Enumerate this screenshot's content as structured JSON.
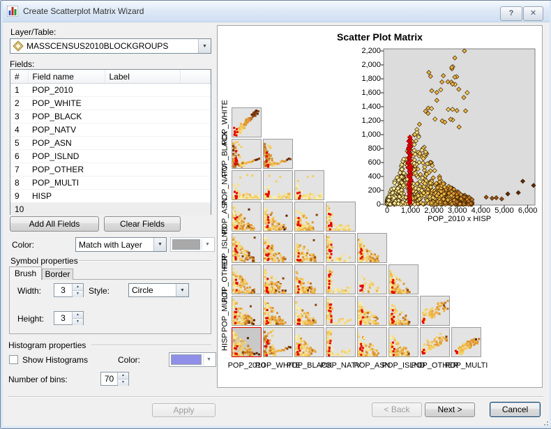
{
  "window": {
    "title": "Create Scatterplot Matrix Wizard",
    "help_label": "?",
    "close_label": "✕"
  },
  "layer_table": {
    "label": "Layer/Table:",
    "value": "MASSCENSUS2010BLOCKGROUPS"
  },
  "fields": {
    "label": "Fields:",
    "columns": [
      "#",
      "Field name",
      "Label"
    ],
    "rows": [
      {
        "n": "1",
        "name": "POP_2010",
        "label": "",
        "highlight": false
      },
      {
        "n": "2",
        "name": "POP_WHITE",
        "label": "",
        "highlight": false
      },
      {
        "n": "3",
        "name": "POP_BLACK",
        "label": "",
        "highlight": false
      },
      {
        "n": "4",
        "name": "POP_NATV",
        "label": "",
        "highlight": false
      },
      {
        "n": "5",
        "name": "POP_ASN",
        "label": "",
        "highlight": false
      },
      {
        "n": "6",
        "name": "POP_ISLND",
        "label": "",
        "highlight": false
      },
      {
        "n": "7",
        "name": "POP_OTHER",
        "label": "",
        "highlight": false
      },
      {
        "n": "8",
        "name": "POP_MULTI",
        "label": "",
        "highlight": false
      },
      {
        "n": "9",
        "name": "HISP",
        "label": "",
        "highlight": false
      },
      {
        "n": "10",
        "name": "",
        "label": "",
        "highlight": true
      }
    ],
    "add_all_label": "Add All Fields",
    "clear_label": "Clear Fields"
  },
  "color_row": {
    "label": "Color:",
    "value": "Match with Layer",
    "swatch_color": "#a9a9a9"
  },
  "symbol_properties": {
    "title": "Symbol properties",
    "tabs": [
      "Brush",
      "Border"
    ],
    "active_tab": "Brush",
    "width_label": "Width:",
    "width_value": "3",
    "height_label": "Height:",
    "height_value": "3",
    "style_label": "Style:",
    "style_value": "Circle"
  },
  "histogram_properties": {
    "title": "Histogram properties",
    "checkbox_label": "Show Histograms",
    "checked": false,
    "color_label": "Color:",
    "color_value": "#8f8fe8",
    "bins_label": "Number of bins:",
    "bins_value": "70"
  },
  "actions": {
    "apply": "Apply",
    "back": "< Back",
    "next": "Next >",
    "cancel": "Cancel"
  },
  "preview": {
    "chart_data": {
      "type": "scatter",
      "title": "Scatter Plot Matrix",
      "main_plot": {
        "xlabel": "POP_2010 x HISP",
        "x_ticks": [
          0,
          1000,
          2000,
          3000,
          4000,
          5000,
          6000
        ],
        "y_ticks": [
          0,
          200,
          400,
          600,
          800,
          1000,
          1200,
          1400,
          1600,
          1800,
          2000,
          2200
        ],
        "xlim": [
          0,
          6400
        ],
        "ylim": [
          0,
          2300
        ],
        "marker": "diamond",
        "palette": [
          "#fbf0a2",
          "#f8e286",
          "#f5cf63",
          "#eeb446",
          "#dd9632",
          "#c17423",
          "#8a4310",
          "#5e2605"
        ],
        "red_color": "#e80000",
        "plot_bg": "#dcdcdc",
        "clusters": [
          {
            "kind": "cloud",
            "n": 680,
            "x_max": 3650,
            "peak_x": 1300,
            "peak_y": 1120,
            "seed": 91
          },
          {
            "kind": "red_stripe",
            "n": 38,
            "x_range": [
              905,
              1025
            ],
            "y_range": [
              20,
              985
            ]
          },
          {
            "kind": "upper_scatter",
            "n": 26,
            "x_range": [
              1380,
              3430
            ],
            "y_range": [
              1090,
              1990
            ]
          }
        ],
        "notable_points": [
          [
            3300,
            2240
          ],
          [
            2890,
            2100
          ],
          [
            2760,
            1965
          ],
          [
            2400,
            1845
          ],
          [
            2890,
            1825
          ],
          [
            2340,
            1755
          ],
          [
            2790,
            1725
          ],
          [
            3060,
            1650
          ],
          [
            2120,
            1605
          ],
          [
            3350,
            1340
          ],
          [
            2980,
            1345
          ]
        ],
        "outliers": [
          [
            5150,
            150
          ],
          [
            5600,
            168
          ],
          [
            5790,
            332
          ],
          [
            6300,
            272
          ],
          [
            4230,
            103
          ],
          [
            4480,
            88
          ],
          [
            4660,
            95
          ],
          [
            4890,
            78
          ]
        ]
      },
      "matrix": {
        "row_labels": [
          "POP_WHITE",
          "POP_BLACK",
          "POP_NATV",
          "POP_ASN",
          "POP_ISLND",
          "POP_OTHER",
          "POP_MULTI",
          "HISP"
        ],
        "col_labels": [
          "POP_2010",
          "POP_WHITE",
          "POP_BLACK",
          "POP_NATV",
          "POP_ASN",
          "POP_ISLND",
          "POP_OTHER",
          "POP_MULTI"
        ],
        "selected": {
          "row": "HISP",
          "col": "POP_2010"
        },
        "cell_bg": "#e3e3e3",
        "selected_bg": "#c9c9c9",
        "patterns": [
          [
            "diag"
          ],
          [
            "valley",
            "valley"
          ],
          [
            "flat",
            "flat",
            "flat"
          ],
          [
            "tri",
            "tri",
            "hug",
            "edge"
          ],
          [
            "tri",
            "tri",
            "hug",
            "edge",
            "hug"
          ],
          [
            "tri",
            "tri",
            "hug",
            "edge",
            "sparse",
            "hug"
          ],
          [
            "tri",
            "tri",
            "hug",
            "edge",
            "hug",
            "hug",
            "rise"
          ],
          [
            "tritail",
            "valley",
            "hug",
            "edge",
            "hug",
            "hug",
            "rise",
            "blob"
          ]
        ]
      }
    }
  }
}
